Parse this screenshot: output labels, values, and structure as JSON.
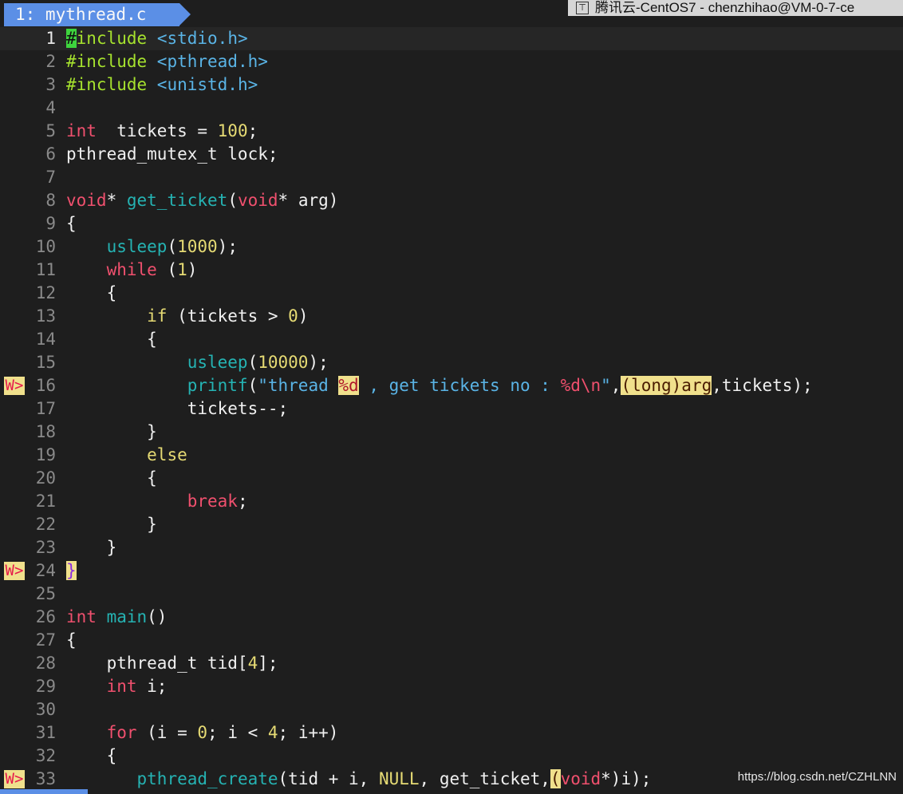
{
  "tab": {
    "label": "1: mythread.c"
  },
  "window_title": "腾讯云-CentOS7 - chenzhihao@VM-0-7-ce",
  "watermark": "https://blog.csdn.net/CZHLNN",
  "sign_marker": "W>",
  "colors": {
    "tab_bg": "#5b8fe6",
    "editor_bg": "#1e1e1e",
    "warn_sign_bg": "#f0e08c",
    "cursor": "#3ed43e"
  },
  "lines": [
    {
      "n": "1",
      "current": true,
      "sign": "",
      "segs": [
        [
          "cursor",
          "#"
        ],
        [
          "pp",
          "include "
        ],
        [
          "str",
          "<stdio.h>"
        ]
      ]
    },
    {
      "n": "2",
      "sign": "",
      "segs": [
        [
          "pp",
          "#include "
        ],
        [
          "str",
          "<pthread.h>"
        ]
      ]
    },
    {
      "n": "3",
      "sign": "",
      "segs": [
        [
          "pp",
          "#include "
        ],
        [
          "str",
          "<unistd.h>"
        ]
      ]
    },
    {
      "n": "4",
      "sign": "",
      "segs": []
    },
    {
      "n": "5",
      "sign": "",
      "segs": [
        [
          "kw",
          "int"
        ],
        [
          "",
          "  tickets = "
        ],
        [
          "num",
          "100"
        ],
        [
          "",
          ";"
        ]
      ]
    },
    {
      "n": "6",
      "sign": "",
      "segs": [
        [
          "",
          "pthread_mutex_t lock;"
        ]
      ]
    },
    {
      "n": "7",
      "sign": "",
      "segs": []
    },
    {
      "n": "8",
      "sign": "",
      "segs": [
        [
          "kw",
          "void"
        ],
        [
          "",
          "* "
        ],
        [
          "fn",
          "get_ticket"
        ],
        [
          "",
          "("
        ],
        [
          "kw",
          "void"
        ],
        [
          "",
          "* arg)"
        ]
      ]
    },
    {
      "n": "9",
      "sign": "",
      "segs": [
        [
          "",
          "{"
        ]
      ]
    },
    {
      "n": "10",
      "sign": "",
      "segs": [
        [
          "",
          "    "
        ],
        [
          "fn",
          "usleep"
        ],
        [
          "",
          "("
        ],
        [
          "num",
          "1000"
        ],
        [
          "",
          ");"
        ]
      ]
    },
    {
      "n": "11",
      "sign": "",
      "segs": [
        [
          "",
          "    "
        ],
        [
          "kw",
          "while"
        ],
        [
          "",
          " ("
        ],
        [
          "num",
          "1"
        ],
        [
          "",
          ")"
        ]
      ]
    },
    {
      "n": "12",
      "sign": "",
      "segs": [
        [
          "",
          "    {"
        ]
      ]
    },
    {
      "n": "13",
      "sign": "",
      "segs": [
        [
          "",
          "        "
        ],
        [
          "cond",
          "if"
        ],
        [
          "",
          " (tickets > "
        ],
        [
          "num",
          "0"
        ],
        [
          "",
          ")"
        ]
      ]
    },
    {
      "n": "14",
      "sign": "",
      "segs": [
        [
          "",
          "        {"
        ]
      ]
    },
    {
      "n": "15",
      "sign": "",
      "segs": [
        [
          "",
          "            "
        ],
        [
          "fn",
          "usleep"
        ],
        [
          "",
          "("
        ],
        [
          "num",
          "10000"
        ],
        [
          "",
          ");"
        ]
      ]
    },
    {
      "n": "16",
      "sign": "W>",
      "segs": [
        [
          "",
          "            "
        ],
        [
          "fn",
          "printf"
        ],
        [
          "",
          "("
        ],
        [
          "str",
          "\"thread "
        ],
        [
          "hl",
          "%d"
        ],
        [
          "str",
          " , get tickets no : "
        ],
        [
          "fmt",
          "%d\\n"
        ],
        [
          "str",
          "\""
        ],
        [
          "",
          ","
        ],
        [
          "hl2",
          "(long)arg"
        ],
        [
          "",
          ",tickets);"
        ]
      ]
    },
    {
      "n": "17",
      "sign": "",
      "segs": [
        [
          "",
          "            tickets--;"
        ]
      ]
    },
    {
      "n": "18",
      "sign": "",
      "segs": [
        [
          "",
          "        }"
        ]
      ]
    },
    {
      "n": "19",
      "sign": "",
      "segs": [
        [
          "",
          "        "
        ],
        [
          "cond",
          "else"
        ]
      ]
    },
    {
      "n": "20",
      "sign": "",
      "segs": [
        [
          "",
          "        {"
        ]
      ]
    },
    {
      "n": "21",
      "sign": "",
      "segs": [
        [
          "",
          "            "
        ],
        [
          "kw",
          "break"
        ],
        [
          "",
          ";"
        ]
      ]
    },
    {
      "n": "22",
      "sign": "",
      "segs": [
        [
          "",
          "        }"
        ]
      ]
    },
    {
      "n": "23",
      "sign": "",
      "segs": [
        [
          "",
          "    }"
        ]
      ]
    },
    {
      "n": "24",
      "sign": "W>",
      "segs": [
        [
          "brace-hl",
          "}"
        ]
      ]
    },
    {
      "n": "25",
      "sign": "",
      "segs": []
    },
    {
      "n": "26",
      "sign": "",
      "segs": [
        [
          "kw",
          "int"
        ],
        [
          "fn",
          " main"
        ],
        [
          "",
          "()"
        ]
      ]
    },
    {
      "n": "27",
      "sign": "",
      "segs": [
        [
          "",
          "{"
        ]
      ]
    },
    {
      "n": "28",
      "sign": "",
      "segs": [
        [
          "",
          "    pthread_t tid["
        ],
        [
          "num",
          "4"
        ],
        [
          "",
          "];"
        ]
      ]
    },
    {
      "n": "29",
      "sign": "",
      "segs": [
        [
          "",
          "    "
        ],
        [
          "kw",
          "int"
        ],
        [
          "",
          " i;"
        ]
      ]
    },
    {
      "n": "30",
      "sign": "",
      "segs": []
    },
    {
      "n": "31",
      "sign": "",
      "segs": [
        [
          "",
          "    "
        ],
        [
          "kw",
          "for"
        ],
        [
          "",
          " (i = "
        ],
        [
          "num",
          "0"
        ],
        [
          "",
          "; i < "
        ],
        [
          "num",
          "4"
        ],
        [
          "",
          "; i++)"
        ]
      ]
    },
    {
      "n": "32",
      "sign": "",
      "segs": [
        [
          "",
          "    {"
        ]
      ]
    },
    {
      "n": "33",
      "sign": "W>",
      "segs": [
        [
          "",
          "       "
        ],
        [
          "fn",
          "pthread_create"
        ],
        [
          "",
          "(tid + i, "
        ],
        [
          "num",
          "NULL"
        ],
        [
          "",
          ", get_ticket,"
        ],
        [
          "hl2",
          "("
        ],
        [
          "kw",
          "void"
        ],
        [
          "",
          "*)i);"
        ]
      ]
    }
  ]
}
